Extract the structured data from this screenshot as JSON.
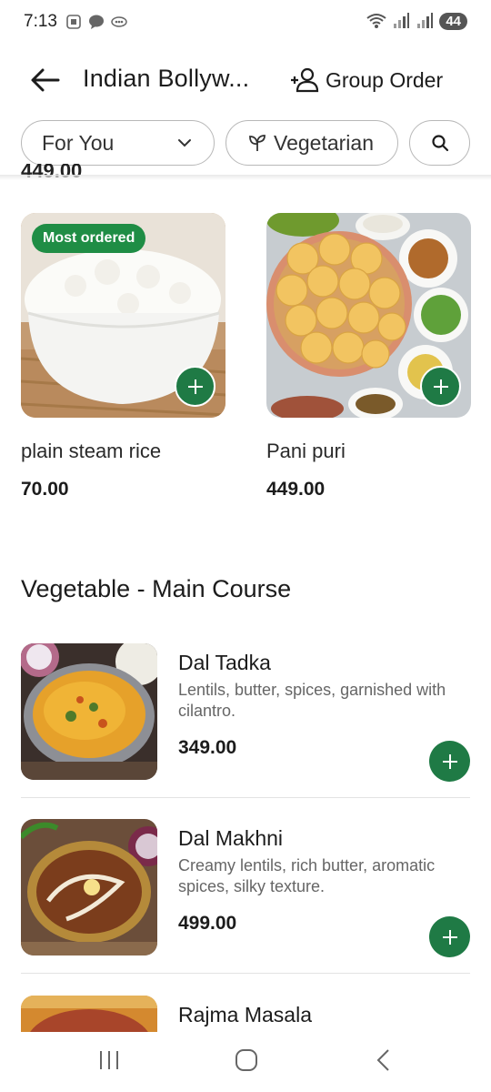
{
  "status_bar": {
    "time": "7:13",
    "battery": "44"
  },
  "header": {
    "title": "Indian Bollyw...",
    "group_order_label": "Group Order"
  },
  "filters": {
    "for_you": "For You",
    "vegetarian": "Vegetarian"
  },
  "previous_price": "449.00",
  "grid_items": [
    {
      "name": "plain steam rice",
      "price": "70.00",
      "badge": "Most ordered"
    },
    {
      "name": "Pani puri",
      "price": "449.00"
    }
  ],
  "section": {
    "title": "Vegetable - Main Course"
  },
  "list_items": [
    {
      "name": "Dal Tadka",
      "description": "Lentils, butter, spices, garnished with cilantro.",
      "price": "349.00"
    },
    {
      "name": "Dal Makhni",
      "description": "Creamy lentils, rich butter, aromatic spices, silky texture.",
      "price": "499.00"
    },
    {
      "name": "Rajma Masala"
    }
  ],
  "colors": {
    "accent_green": "#1f7a45",
    "badge_green": "#1f8d45"
  },
  "icons": [
    "back-arrow-icon",
    "group-order-icon",
    "chevron-down-icon",
    "leaf-icon",
    "search-icon",
    "plus-icon",
    "recent-apps-icon",
    "home-icon",
    "back-nav-icon"
  ]
}
